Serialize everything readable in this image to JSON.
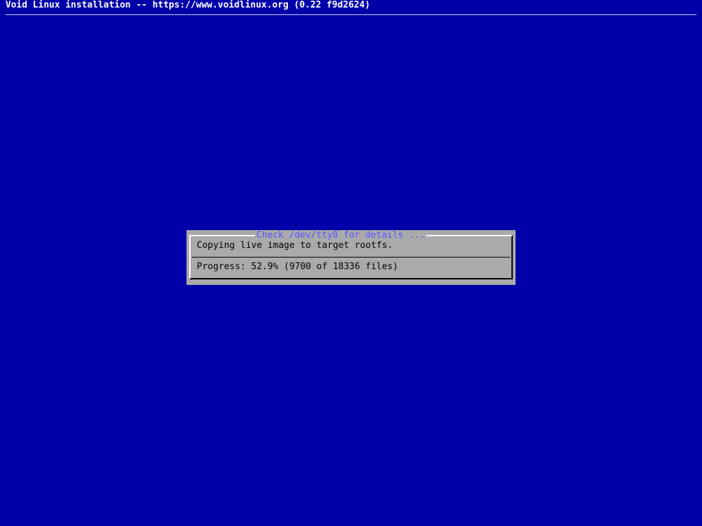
{
  "backtitle": "Void Linux installation -- https://www.voidlinux.org (0.22 f9d2624)",
  "dialog": {
    "title": "Check /dev/tty8 for details ...",
    "message": "Copying live image to target rootfs.",
    "progress_text": "Progress: 52.9% (9700 of 18336 files)",
    "progress": {
      "percent": 52.9,
      "done": 9700,
      "total": 18336,
      "unit": "files"
    }
  },
  "colors": {
    "background": "#0000a8",
    "dialog_bg": "#aaaaaa",
    "title_text": "#5555ff",
    "body_text": "#000000",
    "backtitle_text": "#ffffff"
  }
}
